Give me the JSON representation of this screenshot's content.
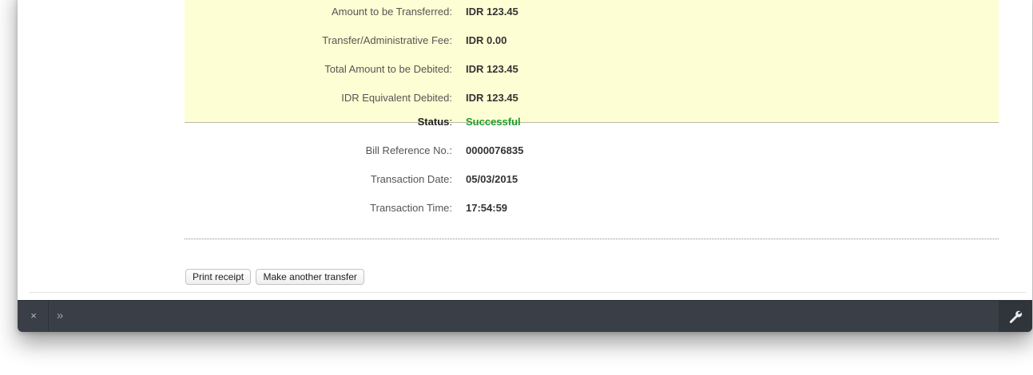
{
  "summary": {
    "rows": [
      {
        "label": "Amount to be Transferred:",
        "value": "IDR 123.45"
      },
      {
        "label": "Transfer/Administrative Fee:",
        "value": "IDR 0.00"
      },
      {
        "label": "Total Amount to be Debited:",
        "value": "IDR 123.45"
      },
      {
        "label": "IDR Equivalent Debited:",
        "value": "IDR 123.45"
      }
    ]
  },
  "details": {
    "status_label": "Status",
    "status_colon": ":",
    "status_value": "Successful",
    "rows": [
      {
        "label": "Bill Reference No.:",
        "value": "0000076835"
      },
      {
        "label": "Transaction Date:",
        "value": "05/03/2015"
      },
      {
        "label": "Transaction Time:",
        "value": "17:54:59"
      }
    ]
  },
  "actions": {
    "print_label": "Print receipt",
    "another_label": "Make another transfer"
  },
  "toolbar": {
    "close_glyph": "×",
    "expand_glyph": "»",
    "close_icon": "close-icon",
    "expand_icon": "double-chevron-right-icon",
    "tools_icon": "wrench-icon"
  },
  "colors": {
    "summary_bg": "#fefed4",
    "success": "#1e9c2c",
    "toolbar_bg": "#3a3f47"
  }
}
